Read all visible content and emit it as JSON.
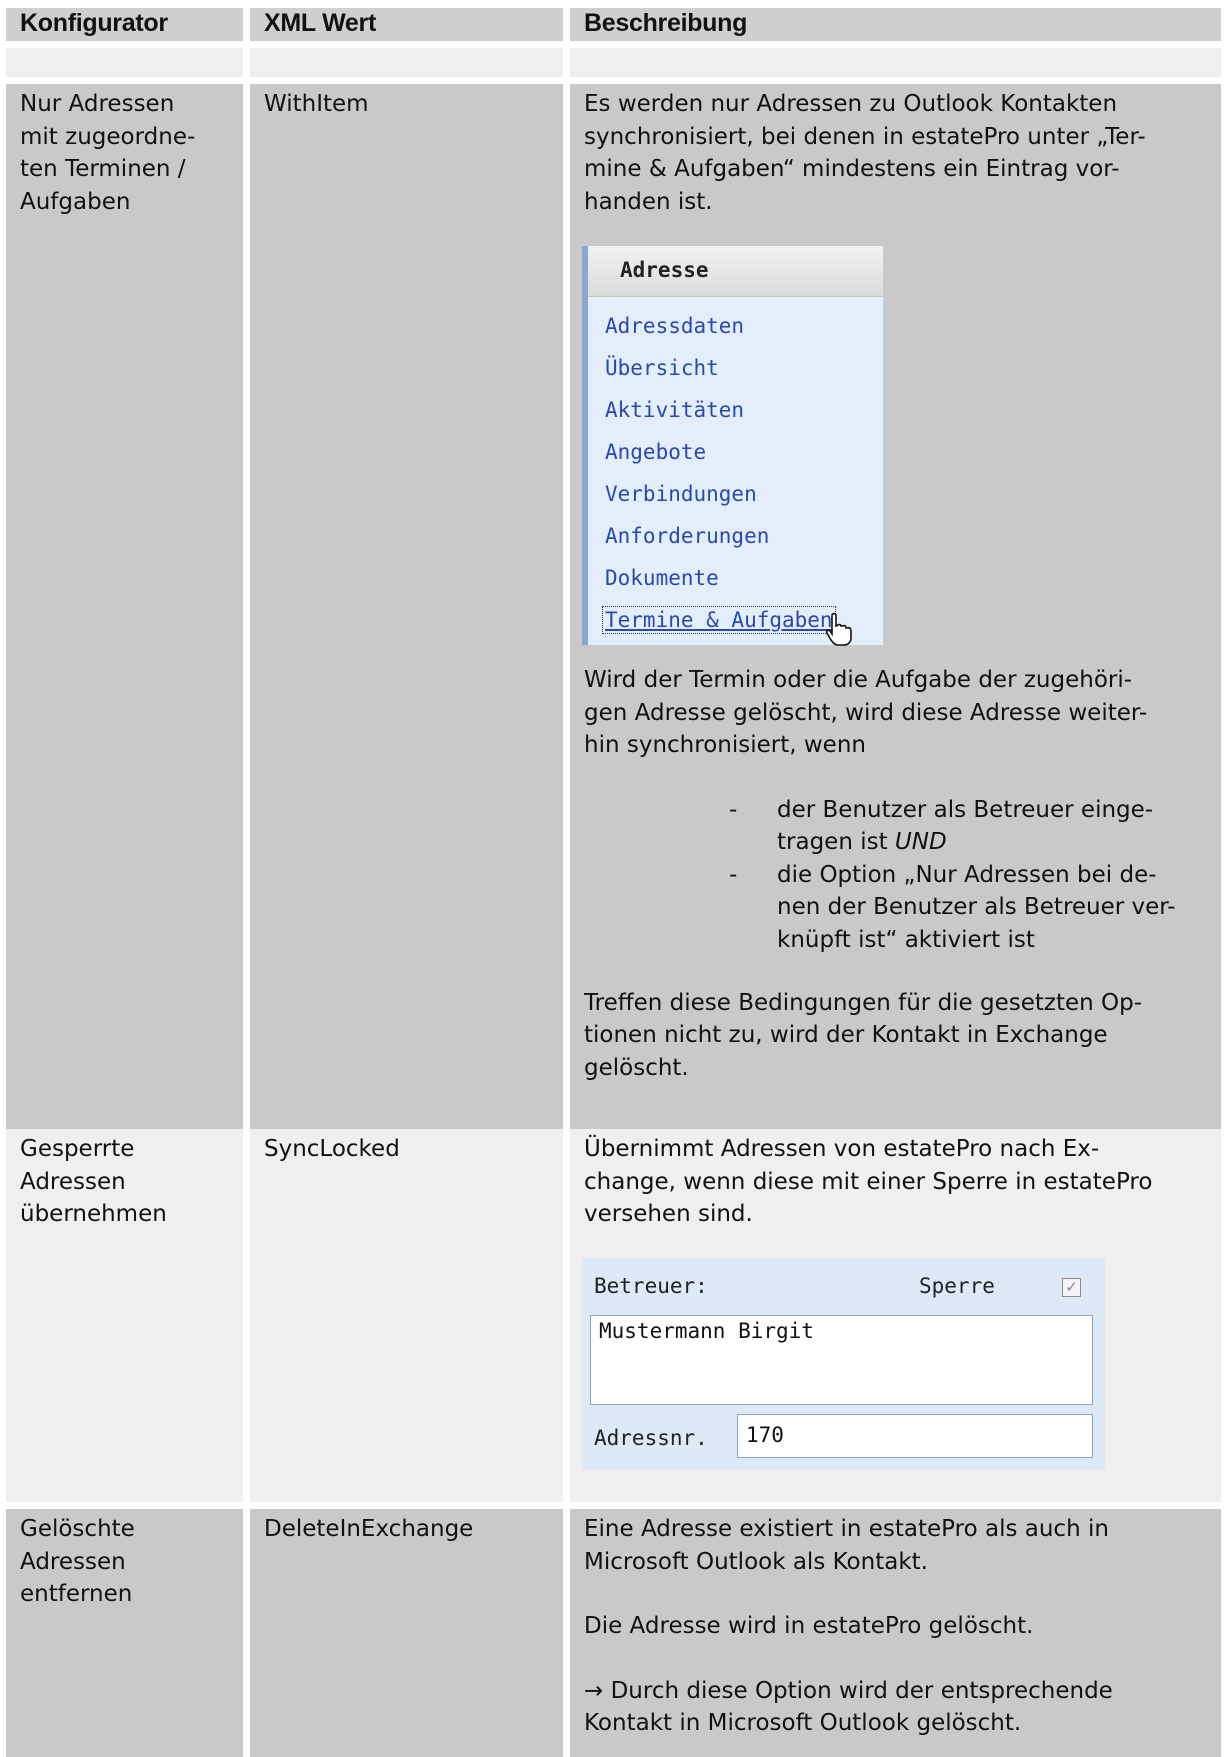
{
  "header": {
    "col1": "Konfigurator",
    "col2": "XML Wert",
    "col3": "Beschreibung"
  },
  "row1": {
    "konfigurator": [
      "Nur Adressen",
      "mit zugeordne-",
      "ten Terminen /",
      "Aufgaben"
    ],
    "xml": "WithItem",
    "desc_intro": [
      "Es werden nur Adressen zu Outlook Kontakten",
      "synchronisiert, bei denen in estatePro unter „Ter-",
      "mine & Aufgaben“ mindestens ein Eintrag vor-",
      "handen ist."
    ],
    "menu": {
      "title": "Adresse",
      "items": [
        "Adressdaten",
        "Übersicht",
        "Aktivitäten",
        "Angebote",
        "Verbindungen",
        "Anforderungen",
        "Dokumente",
        "Termine & Aufgaben"
      ]
    },
    "desc_mid": [
      "Wird der Termin oder die Aufgabe der zugehöri-",
      "gen Adresse gelöscht, wird diese Adresse weiter-",
      "hin synchronisiert, wenn"
    ],
    "list": {
      "dash1": "-",
      "item1_line1": "der Benutzer als Betreuer einge-",
      "item1_line2": "tragen ist",
      "item1_emph": "UND",
      "dash2": "-",
      "item2": [
        "die Option „Nur Adressen bei de-",
        "nen der Benutzer als Betreuer ver-",
        "knüpft ist“ aktiviert ist"
      ]
    },
    "desc_end": [
      "Treffen diese Bedingungen für die gesetzten Op-",
      "tionen nicht zu, wird der Kontakt in Exchange",
      "gelöscht."
    ]
  },
  "row2": {
    "konfigurator": [
      "Gesperrte",
      "Adressen",
      "übernehmen"
    ],
    "xml": "SyncLocked",
    "desc": [
      "Übernimmt Adressen von estatePro nach Ex-",
      "change, wenn diese mit einer Sperre in estatePro",
      "versehen sind."
    ],
    "widget": {
      "betreuer_label": "Betreuer:",
      "sperre_label": "Sperre",
      "sperre_checked": true,
      "betreuer_value": "Mustermann Birgit",
      "adressnr_label": "Adressnr.",
      "adressnr_value": "170"
    }
  },
  "row3": {
    "konfigurator": [
      "Gelöschte",
      "Adressen",
      "entfernen"
    ],
    "xml": "DeleteInExchange",
    "desc_p1": [
      "Eine Adresse existiert in estatePro als auch in",
      "Microsoft Outlook als Kontakt."
    ],
    "desc_p2": "Die Adresse wird in estatePro gelöscht.",
    "desc_p3": [
      "→ Durch diese Option wird der entsprechende",
      "Kontakt in Microsoft Outlook gelöscht."
    ]
  }
}
